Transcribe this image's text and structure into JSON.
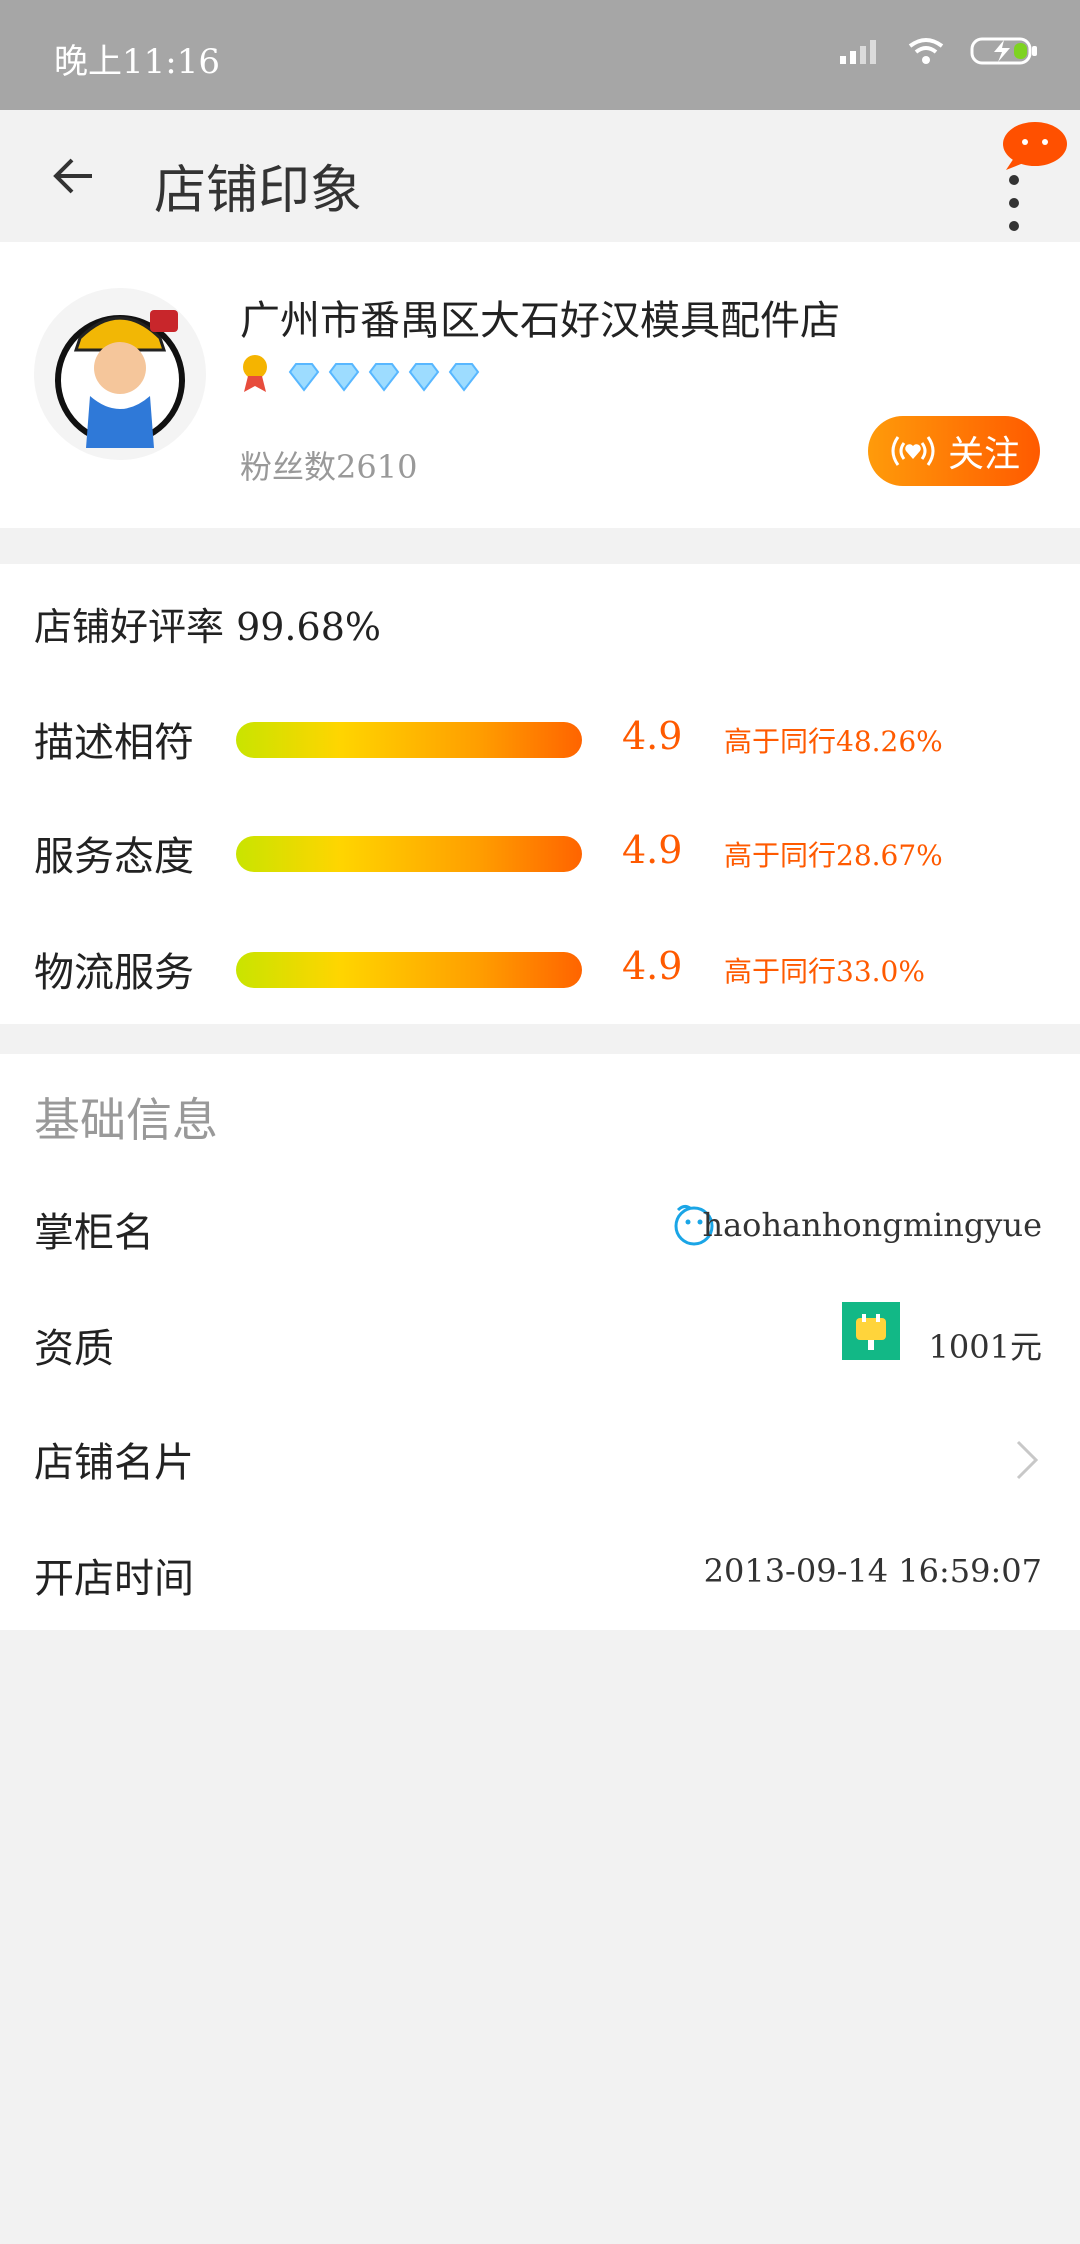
{
  "status_bar": {
    "time": "晚上11:16",
    "icons": [
      "signal-icon",
      "wifi-icon",
      "battery-charging-icon"
    ]
  },
  "app_bar": {
    "title": "店铺印象",
    "back_icon": "back-arrow-icon",
    "more_icon": "more-vertical-icon",
    "bubble_icon": "message-bubble-icon"
  },
  "store": {
    "name": "广州市番禺区大石好汉模具配件店",
    "medal_icon": "gold-medal-icon",
    "diamonds": 5,
    "fans": "粉丝数2610",
    "follow_label": "关注",
    "accent_color": "#ff6a00"
  },
  "ratings": {
    "overall": "店铺好评率 99.68%",
    "items": [
      {
        "label": "描述相符",
        "score": "4.9",
        "compare": "高于同行48.26%"
      },
      {
        "label": "服务态度",
        "score": "4.9",
        "compare": "高于同行28.67%"
      },
      {
        "label": "物流服务",
        "score": "4.9",
        "compare": "高于同行33.0%"
      }
    ]
  },
  "basic_info": {
    "title": "基础信息",
    "rows": [
      {
        "label": "掌柜名",
        "value": "haohanhongmingyue"
      },
      {
        "label": "资质",
        "value": "1001元"
      },
      {
        "label": "店铺名片",
        "value": ""
      },
      {
        "label": "开店时间",
        "value": "2013-09-14 16:59:07"
      }
    ]
  }
}
